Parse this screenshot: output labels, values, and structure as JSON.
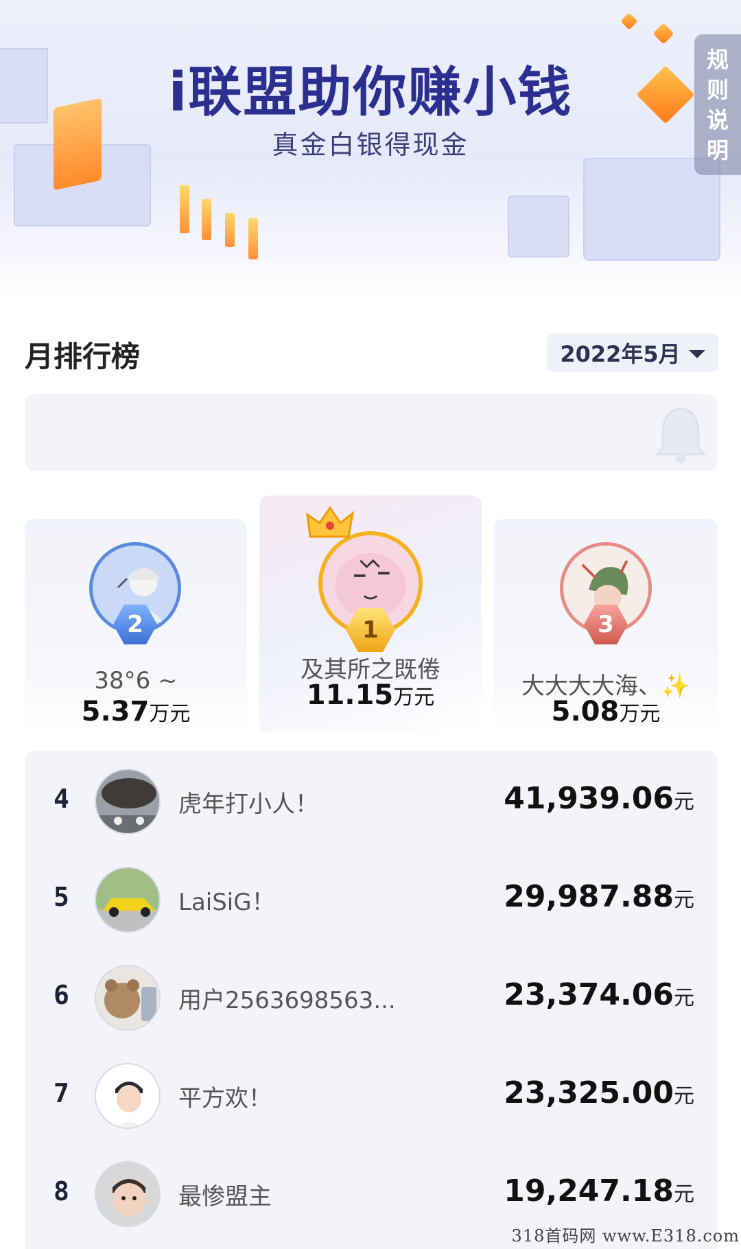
{
  "banner": {
    "title": "i联盟助你赚小钱",
    "subtitle": "真金白银得现金",
    "rules_tab": [
      "规",
      "则",
      "说",
      "明"
    ]
  },
  "ranking": {
    "title": "月排行榜",
    "month": "2022年5月"
  },
  "podium": [
    {
      "rank": "1",
      "name": "及其所之既倦",
      "amount": "11.15",
      "unit": "万元",
      "avatar": "cartoon-face-avatar"
    },
    {
      "rank": "2",
      "name": "38°6 ~",
      "amount": "5.37",
      "unit": "万元",
      "avatar": "person-cap-avatar"
    },
    {
      "rank": "3",
      "name": "大大大大海、✨",
      "amount": "5.08",
      "unit": "万元",
      "avatar": "anime-character-avatar"
    }
  ],
  "list": [
    {
      "rank": "4",
      "name": "虎年打小人！",
      "amount": "41,939.06",
      "unit": "元",
      "avatar": "storm-scene-avatar"
    },
    {
      "rank": "5",
      "name": "LaiSiG！",
      "amount": "29,987.88",
      "unit": "元",
      "avatar": "yellow-car-avatar"
    },
    {
      "rank": "6",
      "name": "用户2563698563...",
      "amount": "23,374.06",
      "unit": "元",
      "avatar": "teddy-bear-avatar"
    },
    {
      "rank": "7",
      "name": "平方欢！",
      "amount": "23,325.00",
      "unit": "元",
      "avatar": "boy-portrait-avatar"
    },
    {
      "rank": "8",
      "name": "最惨盟主",
      "amount": "19,247.18",
      "unit": "元",
      "avatar": "baby-portrait-avatar"
    }
  ],
  "watermark": "318首码网 www.E318.com",
  "colors": {
    "accent": "#2b2f8f",
    "gold": "#f5b21e",
    "silver": "#4f7fd6",
    "bronze": "#d9756c",
    "list_background": "#f2f4f9"
  }
}
